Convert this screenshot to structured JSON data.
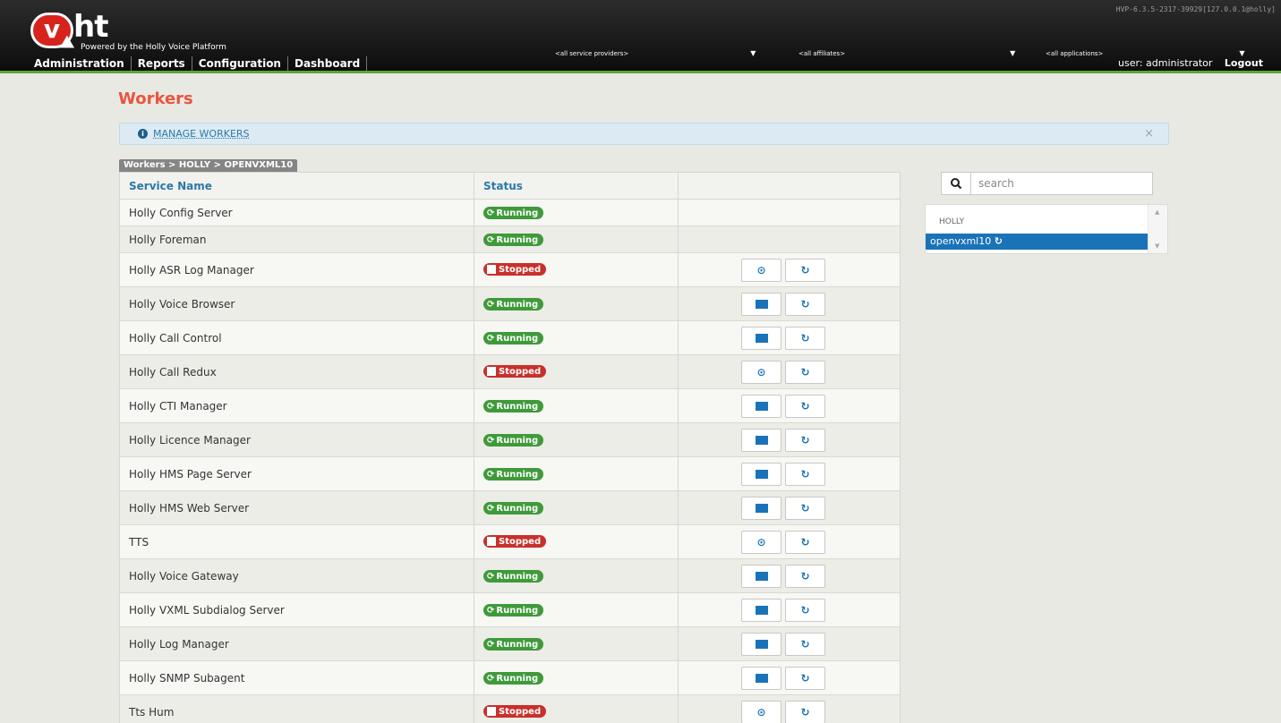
{
  "header": {
    "version": "HVP-6.3.5-2317-39929[127.0.0.1@holly]",
    "logo_text": "ht",
    "logo_badge": "v",
    "tagline": "Powered by the Holly Voice Platform",
    "nav": [
      "Administration",
      "Reports",
      "Configuration",
      "Dashboard"
    ],
    "filters": {
      "service_providers": "<all service providers>",
      "affiliates": "<all affiliates>",
      "applications": "<all applications>"
    },
    "user": "user: administrator",
    "logout": "Logout"
  },
  "page": {
    "title": "Workers",
    "info_label": "MANAGE WORKERS",
    "info_close": "×",
    "breadcrumb": "Workers > HOLLY > OPENVXML10"
  },
  "table": {
    "columns": [
      "Service Name",
      "Status",
      ""
    ],
    "rows": [
      {
        "name": "Holly Config Server",
        "status": "Running"
      },
      {
        "name": "Holly Foreman",
        "status": "Running"
      },
      {
        "name": "Holly ASR Log Manager",
        "status": "Stopped"
      },
      {
        "name": "Holly Voice Browser",
        "status": "Running"
      },
      {
        "name": "Holly Call Control",
        "status": "Running"
      },
      {
        "name": "Holly Call Redux",
        "status": "Stopped"
      },
      {
        "name": "Holly CTI Manager",
        "status": "Running"
      },
      {
        "name": "Holly Licence Manager",
        "status": "Running"
      },
      {
        "name": "Holly HMS Page Server",
        "status": "Running"
      },
      {
        "name": "Holly HMS Web Server",
        "status": "Running"
      },
      {
        "name": "TTS",
        "status": "Stopped"
      },
      {
        "name": "Holly Voice Gateway",
        "status": "Running"
      },
      {
        "name": "Holly VXML Subdialog Server",
        "status": "Running"
      },
      {
        "name": "Holly Log Manager",
        "status": "Running"
      },
      {
        "name": "Holly SNMP Subagent",
        "status": "Running"
      },
      {
        "name": "Tts Hum",
        "status": "Stopped"
      }
    ]
  },
  "sidebar": {
    "search_placeholder": "search",
    "group": "HOLLY",
    "node": "openvxml10"
  },
  "colors": {
    "accent": "#e8563e",
    "running": "#3f9a3a",
    "stopped": "#c9302c",
    "selected": "#1a73b8"
  }
}
